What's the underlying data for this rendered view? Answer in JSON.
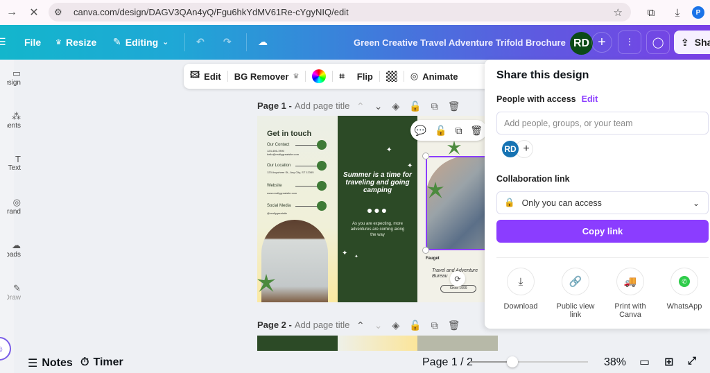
{
  "browser": {
    "url": "canva.com/design/DAGV3QAn4yQ/Fgu6hkYdMV61Re-cYgyNIQ/edit",
    "profile_initial": "P"
  },
  "topbar": {
    "file_label": "File",
    "resize_label": "Resize",
    "editing_label": "Editing",
    "doc_title": "Green Creative Travel Adventure Trifold Brochure",
    "avatar_initials": "RD",
    "share_label": "Share"
  },
  "sidebar": {
    "items": [
      {
        "label": "Design",
        "icon": "design-icon"
      },
      {
        "label": "Elements",
        "icon": "elements-icon"
      },
      {
        "label": "Text",
        "icon": "text-icon"
      },
      {
        "label": "Brand",
        "icon": "brand-icon"
      },
      {
        "label": "Uploads",
        "icon": "uploads-icon"
      },
      {
        "label": "Draw",
        "icon": "draw-icon"
      }
    ]
  },
  "context_toolbar": {
    "edit_label": "Edit",
    "bg_remover_label": "BG Remover",
    "flip_label": "Flip",
    "animate_label": "Animate"
  },
  "pages": [
    {
      "label": "Page 1 -",
      "title_placeholder": "Add page title"
    },
    {
      "label": "Page 2 -",
      "title_placeholder": "Add page title"
    }
  ],
  "design": {
    "panel1": {
      "title": "Get in touch",
      "items": [
        {
          "label": "Our Contact",
          "detail": "123-456-7890 hello@reallygreatsite.com"
        },
        {
          "label": "Our Location",
          "detail": "123 Anywhere St., Any City, ST 12345"
        },
        {
          "label": "Website",
          "detail": "www.reallygreatsite.com"
        },
        {
          "label": "Social Media",
          "detail": "@reallygreatsite"
        }
      ]
    },
    "panel2": {
      "headline": "Summer is a time for traveling and going camping",
      "dots": "●●●",
      "subtext": "As you are expecting, more adventures are coming along the way"
    },
    "panel3": {
      "brand": "Fauget",
      "tagline": "Travel and Adventure Bureau",
      "since": "Since 1999"
    }
  },
  "share_panel": {
    "title": "Share this design",
    "people_label": "People with access",
    "edit_link": "Edit",
    "input_placeholder": "Add people, groups, or your team",
    "member_initials": "RD",
    "collab_label": "Collaboration link",
    "access_value": "Only you can access",
    "copy_link_label": "Copy link",
    "actions": [
      {
        "label": "Download",
        "icon": "download-icon"
      },
      {
        "label": "Public view link",
        "icon": "link-icon"
      },
      {
        "label": "Print with Canva",
        "icon": "truck-icon"
      },
      {
        "label": "WhatsApp",
        "icon": "whatsapp-icon"
      }
    ]
  },
  "bottom_bar": {
    "notes_label": "Notes",
    "timer_label": "Timer",
    "page_indicator": "Page 1 / 2",
    "zoom_percent": "38%",
    "zoom_fraction": 0.36
  },
  "colors": {
    "accent_purple": "#8b3dff",
    "avatar_green": "#0b4a17",
    "member_blue": "#1673b3",
    "design_green": "#2c4a26"
  }
}
